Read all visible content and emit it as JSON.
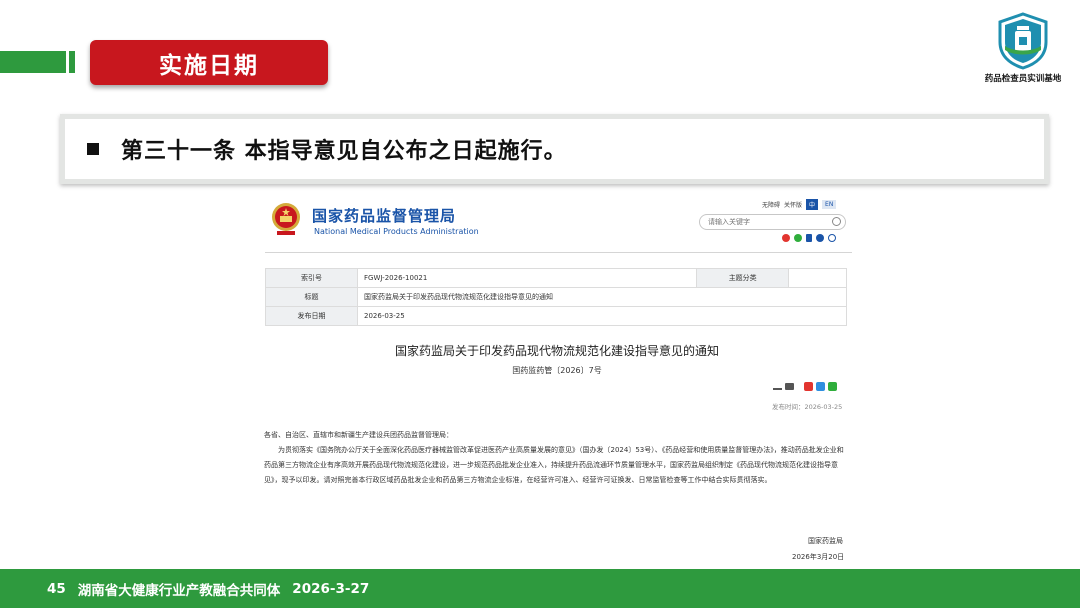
{
  "header": {
    "section_title": "实施日期"
  },
  "logo": {
    "caption": "药品检查员实训基地"
  },
  "article": {
    "text": "第三十一条  本指导意见自公布之日起施行。"
  },
  "website": {
    "agency_cn": "国家药品监督管理局",
    "agency_en": "National Medical Products Administration",
    "top_links": [
      "无障碍",
      "关怀版"
    ],
    "lang_cn": "中",
    "lang_en": "EN",
    "search_placeholder": "请输入关键字",
    "meta": {
      "index_label": "索引号",
      "index_value": "FGWJ-2026-10021",
      "category_label": "主题分类",
      "category_value": "",
      "title_label": "标题",
      "title_value": "国家药监局关于印发药品现代物流规范化建设指导意见的通知",
      "date_label": "发布日期",
      "date_value": "2026-03-25"
    },
    "notice_title": "国家药监局关于印发药品现代物流规范化建设指导意见的通知",
    "notice_number": "国药监药管〔2026〕7号",
    "publish_time": "发布时间：2026-03-25",
    "salutation": "各省、自治区、直辖市和新疆生产建设兵团药品监督管理局：",
    "body": "为贯彻落实《国务院办公厅关于全面深化药品医疗器械监管改革促进医药产业高质量发展的意见》（国办发〔2024〕53号）、《药品经营和使用质量监督管理办法》，推动药品批发企业和药品第三方物流企业有序高效开展药品现代物流规范化建设，进一步规范药品批发企业准入，持续提升药品流通环节质量管理水平，国家药监局组织制定《药品现代物流规范化建设指导意见》，现予以印发。请对照完善本行政区域药品批发企业和药品第三方物流企业标准，在经营许可准入、经营许可证换发、日常监管检查等工作中结合实际贯彻落实。",
    "signature": "国家药监局",
    "sign_date": "2026年3月20日"
  },
  "footer": {
    "page": "45",
    "org": "湖南省大健康行业产教融合共同体",
    "date": "2026-3-27"
  },
  "colors": {
    "brand_green": "#2e9a3e",
    "title_red": "#c8171e",
    "nmpa_blue": "#1a54a8"
  }
}
